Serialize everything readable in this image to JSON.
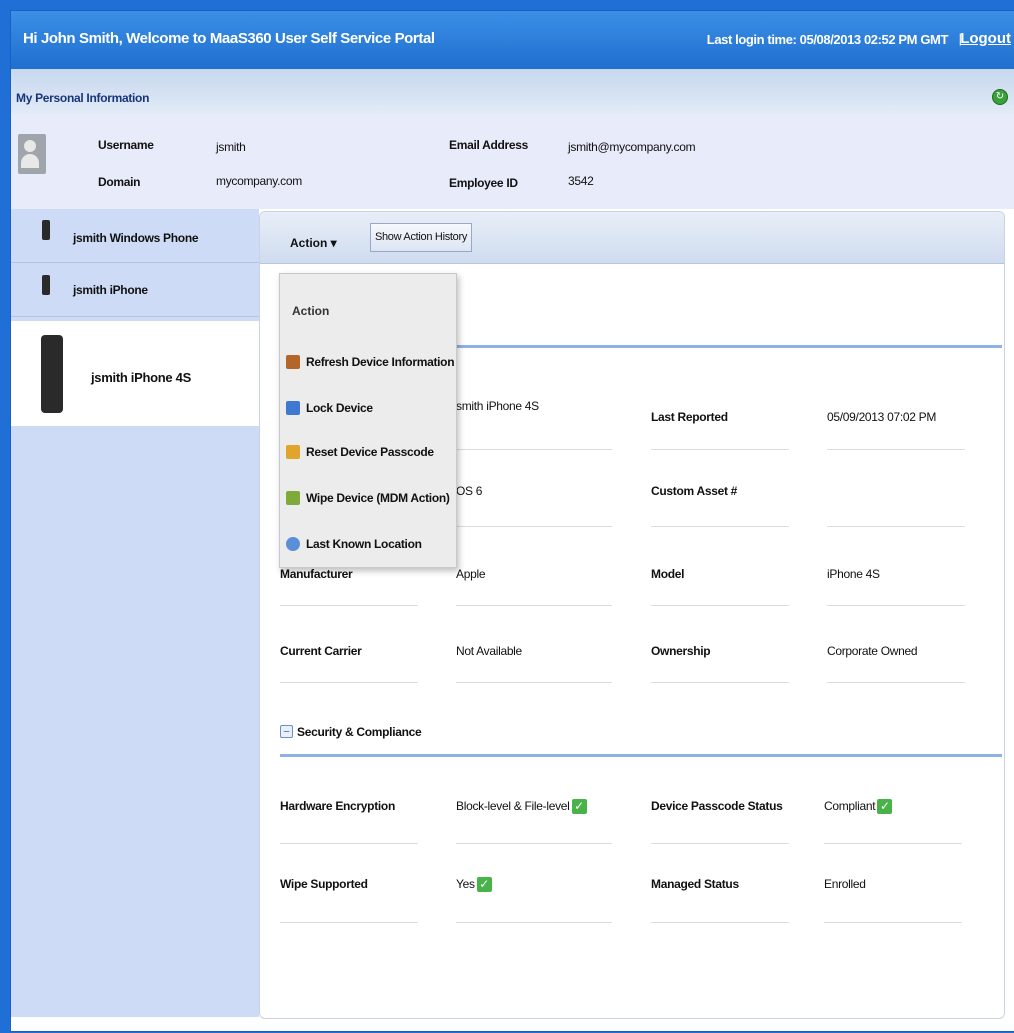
{
  "topbar": {
    "welcome": "Hi John Smith, Welcome to MaaS360 User Self Service Portal",
    "last_login": "Last login time: 05/08/2013 02:52 PM GMT",
    "separator": "|",
    "logout": "Logout"
  },
  "personal_info": {
    "title": "My Personal Information",
    "username_label": "Username",
    "username": "jsmith",
    "domain_label": "Domain",
    "domain": "mycompany.com",
    "email_label": "Email Address",
    "email": "jsmith@mycompany.com",
    "employee_label": "Employee ID",
    "employee_id": "3542"
  },
  "devices": [
    {
      "label": "jsmith Windows Phone"
    },
    {
      "label": "jsmith iPhone"
    },
    {
      "label": "jsmith iPhone 4S"
    }
  ],
  "toolbar": {
    "action_label": "Action ▾",
    "history_label": "Show Action History"
  },
  "action_menu": {
    "header": "Action",
    "items": [
      {
        "label": "Refresh Device Information",
        "icon": "refresh-icon"
      },
      {
        "label": "Lock Device",
        "icon": "lock-icon"
      },
      {
        "label": "Reset Device Passcode",
        "icon": "passcode-icon"
      },
      {
        "label": "Wipe Device (MDM Action)",
        "icon": "wipe-icon"
      },
      {
        "label": "Last Known Location",
        "icon": "location-icon"
      }
    ]
  },
  "details": {
    "device_name_value": "smith iPhone 4S",
    "last_reported_label": "Last Reported",
    "last_reported_value": "05/09/2013 07:02 PM",
    "os_value": "OS 6",
    "custom_asset_label": "Custom Asset #",
    "manufacturer_label": "Manufacturer",
    "manufacturer_value": "Apple",
    "model_label": "Model",
    "model_value": "iPhone 4S",
    "carrier_label": "Current Carrier",
    "carrier_value": "Not Available",
    "ownership_label": "Ownership",
    "ownership_value": "Corporate Owned"
  },
  "security": {
    "section_title": "Security & Compliance",
    "toggle": "–",
    "hw_encryption_label": "Hardware Encryption",
    "hw_encryption_value": "Block-level & File-level",
    "passcode_status_label": "Device Passcode Status",
    "passcode_status_value": "Compliant",
    "wipe_supported_label": "Wipe Supported",
    "wipe_supported_value": "Yes",
    "managed_status_label": "Managed Status",
    "managed_status_value": "Enrolled"
  },
  "check_glyph": "✓",
  "refresh_glyph": "↻"
}
